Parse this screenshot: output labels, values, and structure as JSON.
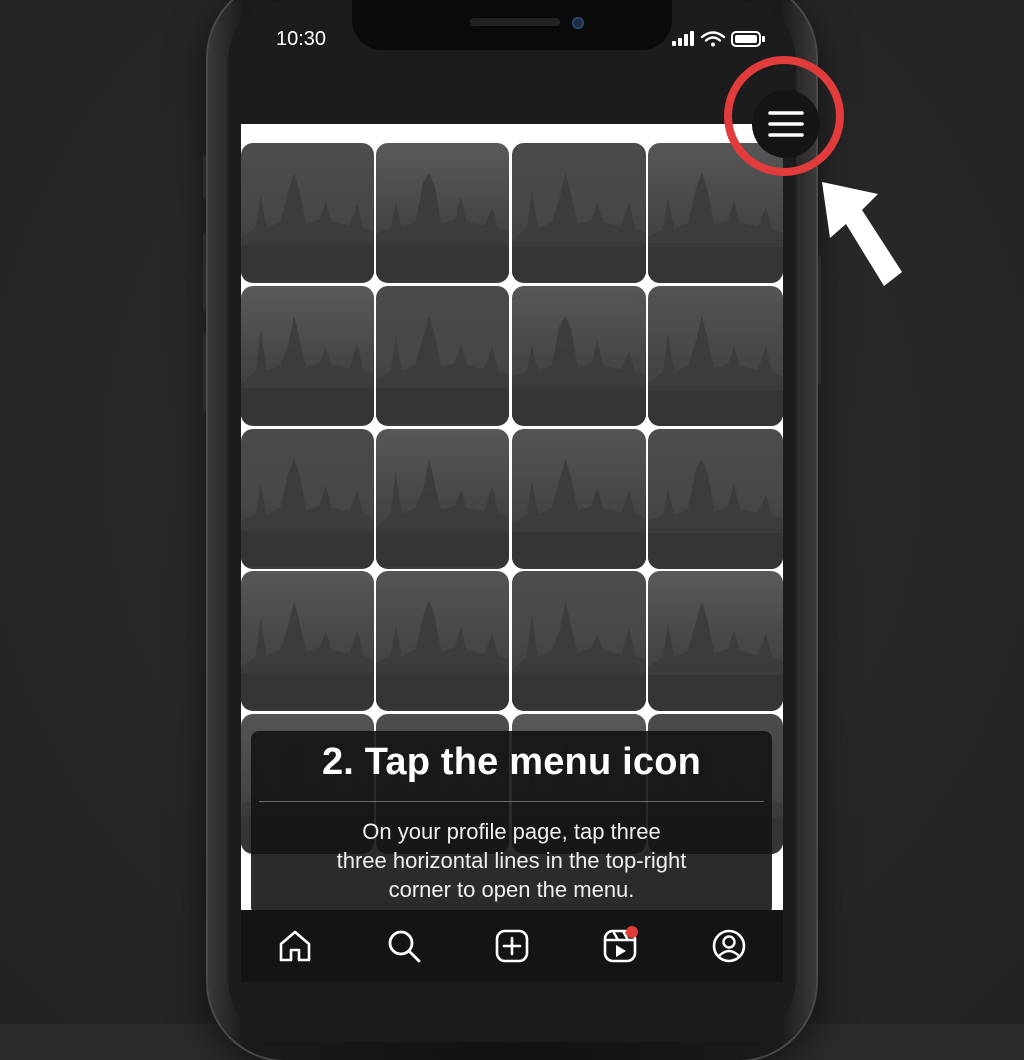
{
  "status_bar": {
    "time": "10:30"
  },
  "grid": {
    "tile_count": 20
  },
  "menu": {
    "icon": "hamburger-menu-icon",
    "highlight_color": "#e23b3b"
  },
  "caption": {
    "title": "2. Tap the menu icon",
    "lines": [
      "On your profile page, tap three",
      "three horizontal lines in the top-right",
      "corner to open the menu."
    ]
  },
  "bottom_nav": {
    "items": [
      {
        "icon": "home-icon"
      },
      {
        "icon": "search-icon"
      },
      {
        "icon": "create-post-icon"
      },
      {
        "icon": "reels-icon",
        "has_notification": true
      },
      {
        "icon": "profile-icon"
      }
    ],
    "notification_color": "#e23b3b"
  }
}
